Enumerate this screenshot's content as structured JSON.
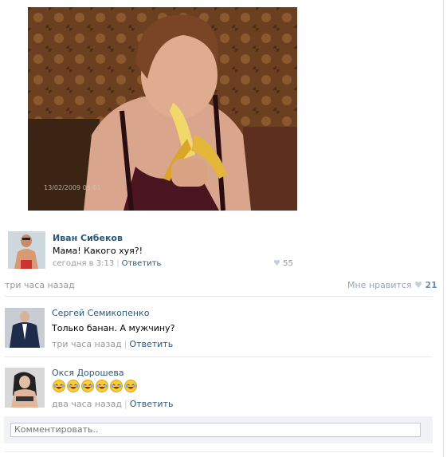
{
  "post": {
    "photo_stamp": "13/02/2009 05:01",
    "top_comment": {
      "author": "Иван Сибеков",
      "text": "Мама! Какого хуя?!",
      "time": "сегодня в 3:13",
      "reply": "Ответить",
      "likes": "55"
    },
    "time": "три часа назад",
    "like_label": "Мне нравится",
    "like_count": "21"
  },
  "comments": [
    {
      "author": "Сергей Семикопенко",
      "text": "Только банан. А мужчину?",
      "time": "три часа назад",
      "reply": "Ответить"
    },
    {
      "author": "Окся Дорошева",
      "time": "два часа назад",
      "reply": "Ответить",
      "emoji_count": 6
    }
  ],
  "composer": {
    "placeholder": "Комментировать.."
  },
  "colors": {
    "link": "#2b587a",
    "meta": "#999999",
    "heart": "#c3cfd9"
  },
  "icons": {
    "heart": "heart-icon",
    "emoji": "laughing-tears-emoji"
  }
}
